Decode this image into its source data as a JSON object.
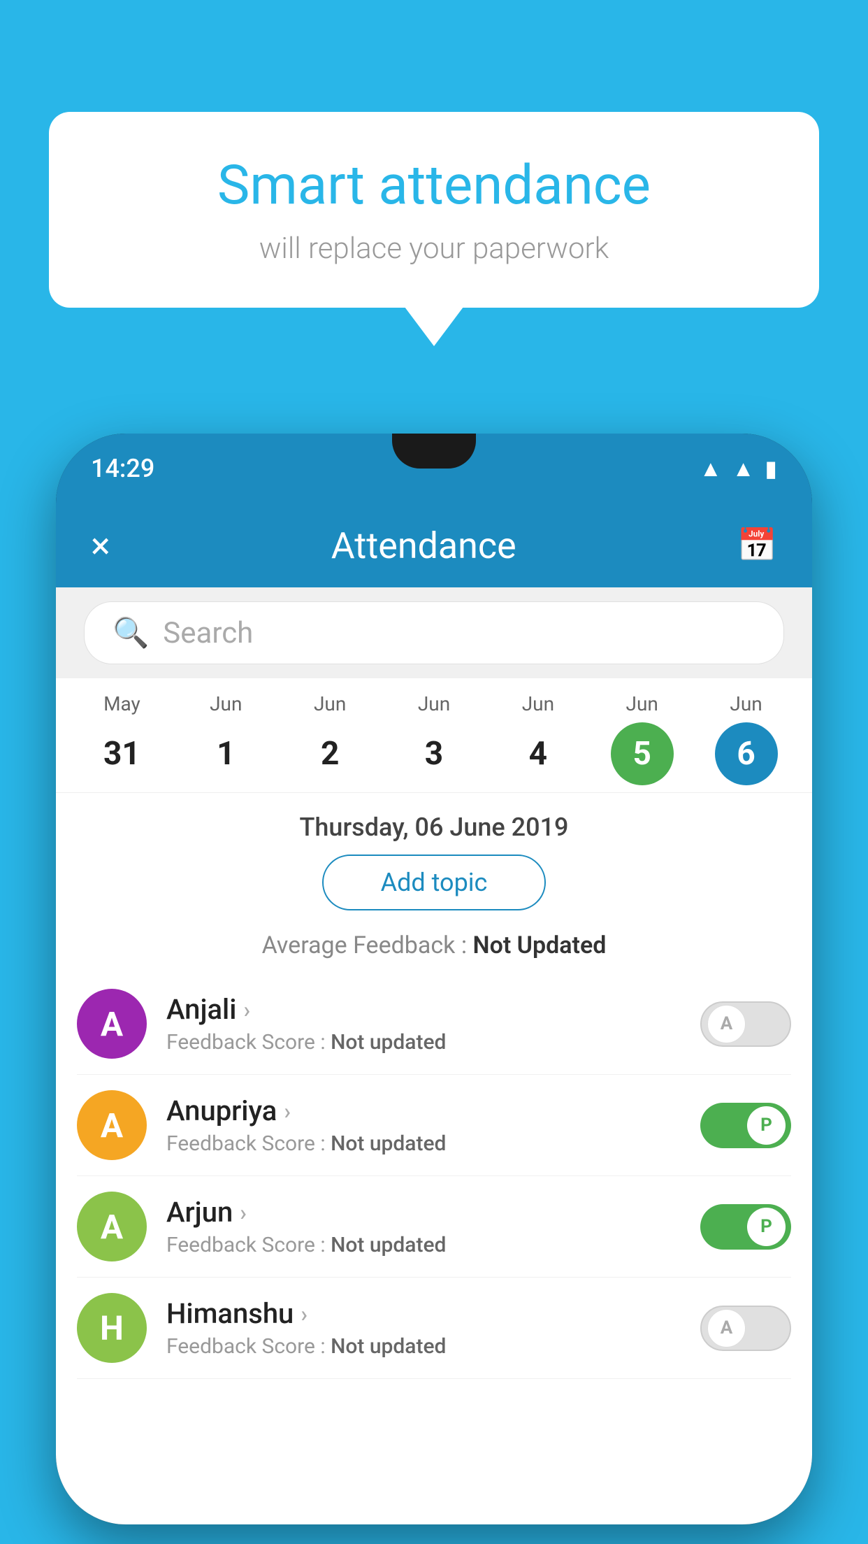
{
  "background_color": "#29b6e8",
  "speech_bubble": {
    "title": "Smart attendance",
    "subtitle": "will replace your paperwork"
  },
  "phone": {
    "status_bar": {
      "time": "14:29"
    },
    "app_header": {
      "title": "Attendance",
      "close_label": "×",
      "calendar_icon": "calendar"
    },
    "search": {
      "placeholder": "Search"
    },
    "calendar": {
      "days": [
        {
          "month": "May",
          "date": "31",
          "state": "normal"
        },
        {
          "month": "Jun",
          "date": "1",
          "state": "normal"
        },
        {
          "month": "Jun",
          "date": "2",
          "state": "normal"
        },
        {
          "month": "Jun",
          "date": "3",
          "state": "normal"
        },
        {
          "month": "Jun",
          "date": "4",
          "state": "normal"
        },
        {
          "month": "Jun",
          "date": "5",
          "state": "today"
        },
        {
          "month": "Jun",
          "date": "6",
          "state": "selected"
        }
      ]
    },
    "selected_date": "Thursday, 06 June 2019",
    "add_topic_label": "Add topic",
    "avg_feedback_label": "Average Feedback :",
    "avg_feedback_value": "Not Updated",
    "students": [
      {
        "name": "Anjali",
        "avatar_letter": "A",
        "avatar_color": "#9c27b0",
        "feedback_label": "Feedback Score :",
        "feedback_value": "Not updated",
        "attendance": "absent",
        "toggle_label": "A"
      },
      {
        "name": "Anupriya",
        "avatar_letter": "A",
        "avatar_color": "#f5a623",
        "feedback_label": "Feedback Score :",
        "feedback_value": "Not updated",
        "attendance": "present",
        "toggle_label": "P"
      },
      {
        "name": "Arjun",
        "avatar_letter": "A",
        "avatar_color": "#8bc34a",
        "feedback_label": "Feedback Score :",
        "feedback_value": "Not updated",
        "attendance": "present",
        "toggle_label": "P"
      },
      {
        "name": "Himanshu",
        "avatar_letter": "H",
        "avatar_color": "#8bc34a",
        "feedback_label": "Feedback Score :",
        "feedback_value": "Not updated",
        "attendance": "absent",
        "toggle_label": "A"
      }
    ]
  }
}
